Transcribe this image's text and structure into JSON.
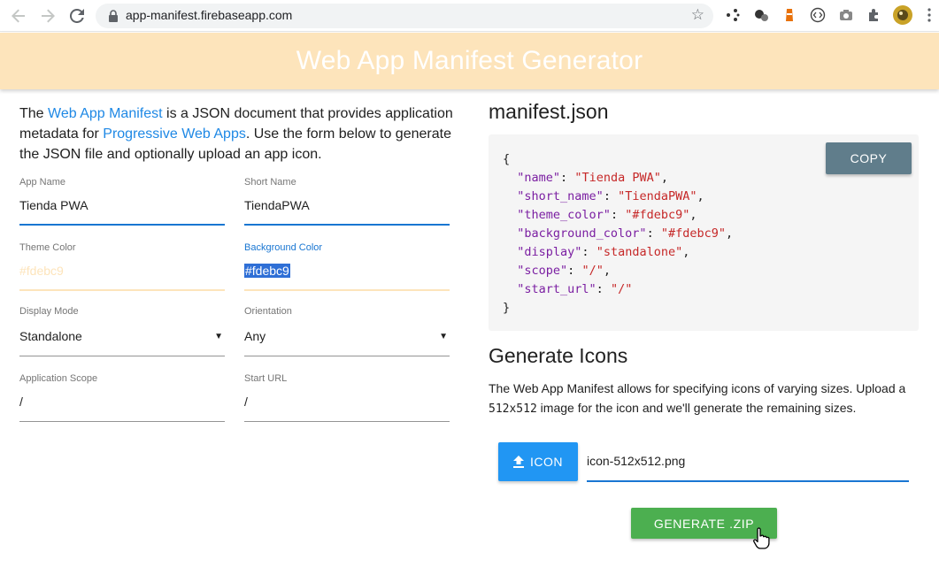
{
  "browser": {
    "url": "app-manifest.firebaseapp.com"
  },
  "header": {
    "title": "Web App Manifest Generator",
    "background_color": "#fde4bb"
  },
  "intro": {
    "text_1": "The ",
    "link_1": "Web App Manifest",
    "text_2": " is a JSON document that provides application metadata for ",
    "link_2": "Progressive Web Apps",
    "text_3": ". Use the form below to generate the JSON file and optionally upload an app icon."
  },
  "form": {
    "app_name": {
      "label": "App Name",
      "value": "Tienda PWA"
    },
    "short_name": {
      "label": "Short Name",
      "value": "TiendaPWA"
    },
    "theme_color": {
      "label": "Theme Color",
      "value": "#fdebc9"
    },
    "background_color": {
      "label": "Background Color",
      "value": "#fdebc9"
    },
    "display_mode": {
      "label": "Display Mode",
      "value": "Standalone"
    },
    "orientation": {
      "label": "Orientation",
      "value": "Any"
    },
    "application_scope": {
      "label": "Application Scope",
      "value": "/"
    },
    "start_url": {
      "label": "Start URL",
      "value": "/"
    }
  },
  "manifest": {
    "heading": "manifest.json",
    "copy_label": "COPY",
    "open_brace": "{",
    "close_brace": "}",
    "entries": [
      {
        "key": "\"name\"",
        "value": "\"Tienda PWA\"",
        "sep": ","
      },
      {
        "key": "\"short_name\"",
        "value": "\"TiendaPWA\"",
        "sep": ","
      },
      {
        "key": "\"theme_color\"",
        "value": "\"#fdebc9\"",
        "sep": ","
      },
      {
        "key": "\"background_color\"",
        "value": "\"#fdebc9\"",
        "sep": ","
      },
      {
        "key": "\"display\"",
        "value": "\"standalone\"",
        "sep": ","
      },
      {
        "key": "\"scope\"",
        "value": "\"/\"",
        "sep": ","
      },
      {
        "key": "\"start_url\"",
        "value": "\"/\"",
        "sep": ""
      }
    ]
  },
  "icons": {
    "heading": "Generate Icons",
    "desc_1": "The Web App Manifest allows for specifying icons of varying sizes. Upload a ",
    "desc_size": "512x512",
    "desc_2": " image for the icon and we'll generate the remaining sizes.",
    "icon_button_label": "ICON",
    "file_name": "icon-512x512.png",
    "generate_label": "GENERATE .ZIP"
  },
  "colors": {
    "accent_blue": "#1976d2",
    "icon_button": "#2196f3",
    "copy_button": "#607d8b",
    "generate_button": "#4caf50"
  }
}
